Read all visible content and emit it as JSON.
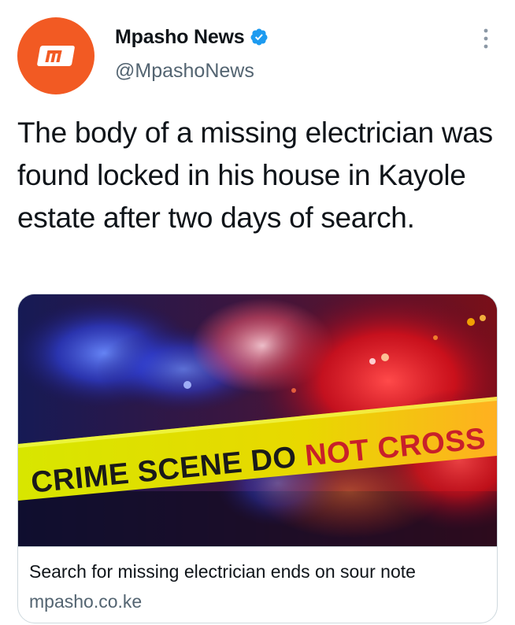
{
  "account": {
    "display_name": "Mpasho News",
    "handle": "@MpashoNews",
    "verified": true,
    "avatar_logo_text": "m",
    "avatar_color": "#f25a23"
  },
  "tweet": {
    "text": "The body of a missing electrician was found locked in his house in Kayole estate after two days of search."
  },
  "link_card": {
    "image_text": "CRIME SCENE DO NOT CROSS",
    "title": "Search for missing electrician ends on sour note",
    "domain": "mpasho.co.ke"
  },
  "colors": {
    "verified_blue": "#1d9bf0",
    "secondary_text": "#536471",
    "tape_yellow": "#e4e800",
    "police_red": "#ff1a1a",
    "police_blue": "#3050ff"
  },
  "icons": {
    "verified": "verified-badge-icon",
    "more": "more-vertical-icon"
  }
}
